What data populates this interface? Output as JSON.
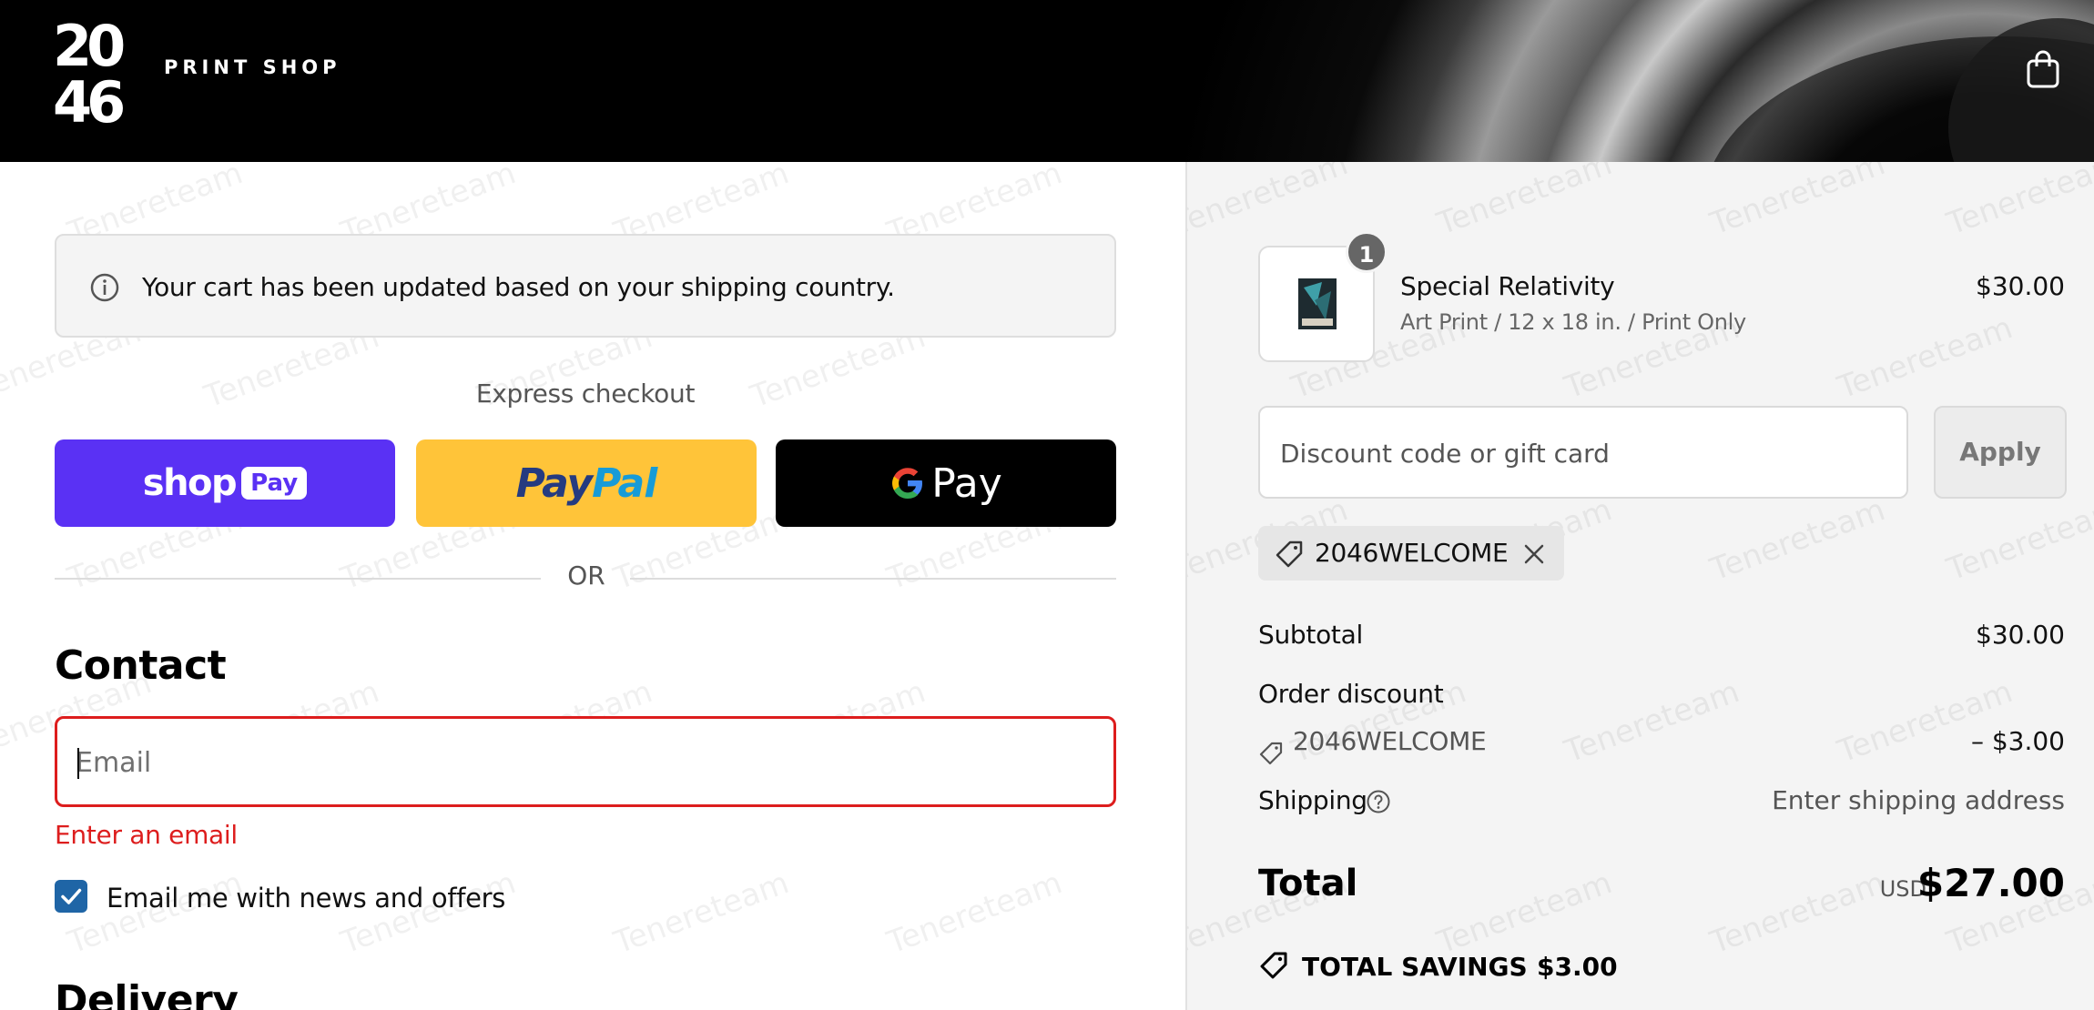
{
  "header": {
    "logo_top": "20",
    "logo_bottom": "46",
    "shop_name": "PRINT SHOP"
  },
  "notice": {
    "text": "Your cart has been updated based on your shipping country."
  },
  "express": {
    "label": "Express checkout",
    "shop_pay": {
      "word": "shop",
      "badge": "Pay"
    },
    "paypal": {
      "pay": "Pay",
      "pal": "Pal"
    },
    "gpay": {
      "word": "Pay"
    }
  },
  "divider": {
    "or": "OR"
  },
  "contact": {
    "heading": "Contact",
    "email_placeholder": "Email",
    "error": "Enter an email",
    "newsletter_label": "Email me with news and offers",
    "newsletter_checked": true
  },
  "delivery": {
    "heading": "Delivery"
  },
  "watermark": {
    "text": "Tenereteam"
  },
  "summary": {
    "product": {
      "name": "Special Relativity",
      "variant": "Art Print / 12 x 18 in. / Print Only",
      "price": "$30.00",
      "quantity": "1"
    },
    "discount_placeholder": "Discount code or gift card",
    "apply_label": "Apply",
    "applied_code": "2046WELCOME",
    "subtotal_label": "Subtotal",
    "subtotal_value": "$30.00",
    "order_discount_label": "Order discount",
    "order_discount_code": "2046WELCOME",
    "order_discount_value": "– $3.00",
    "shipping_label": "Shipping",
    "shipping_value": "Enter shipping address",
    "total_label": "Total",
    "total_currency": "USD",
    "total_value": "$27.00",
    "savings_label": "TOTAL SAVINGS",
    "savings_value": "$3.00"
  },
  "colors": {
    "header_bg": "#000000",
    "shop_pay": "#5a31f4",
    "paypal": "#ffc439",
    "gpay": "#000000",
    "error": "#dd1d1d",
    "checkbox": "#1f65a6",
    "summary_bg": "#f4f4f4"
  }
}
